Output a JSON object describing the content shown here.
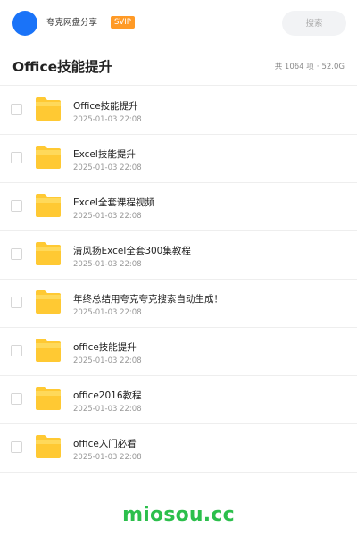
{
  "header": {
    "brand": "夸克网盘分享",
    "badge": "SVIP",
    "search_placeholder": "搜索"
  },
  "folder": {
    "title": "Office技能提升",
    "count_text": "共 1064 项",
    "size_text": "52.0G"
  },
  "items": [
    {
      "name": "Office技能提升",
      "date": "2025-01-03 22:08"
    },
    {
      "name": "Excel技能提升",
      "date": "2025-01-03 22:08"
    },
    {
      "name": "Excel全套课程视频",
      "date": "2025-01-03 22:08"
    },
    {
      "name": "清风扬Excel全套300集教程",
      "date": "2025-01-03 22:08"
    },
    {
      "name": "年终总结用夸克夸克搜索自动生成！",
      "date": "2025-01-03 22:08"
    },
    {
      "name": "office技能提升",
      "date": "2025-01-03 22:08"
    },
    {
      "name": "office2016教程",
      "date": "2025-01-03 22:08"
    },
    {
      "name": "office入门必看",
      "date": "2025-01-03 22:08"
    }
  ],
  "footer": {
    "watermark": "miosou.cc"
  },
  "colors": {
    "avatar": "#1a73f8",
    "badge": "#ff9a26",
    "folder": "#ffc933",
    "watermark": "#2cbf4c"
  }
}
